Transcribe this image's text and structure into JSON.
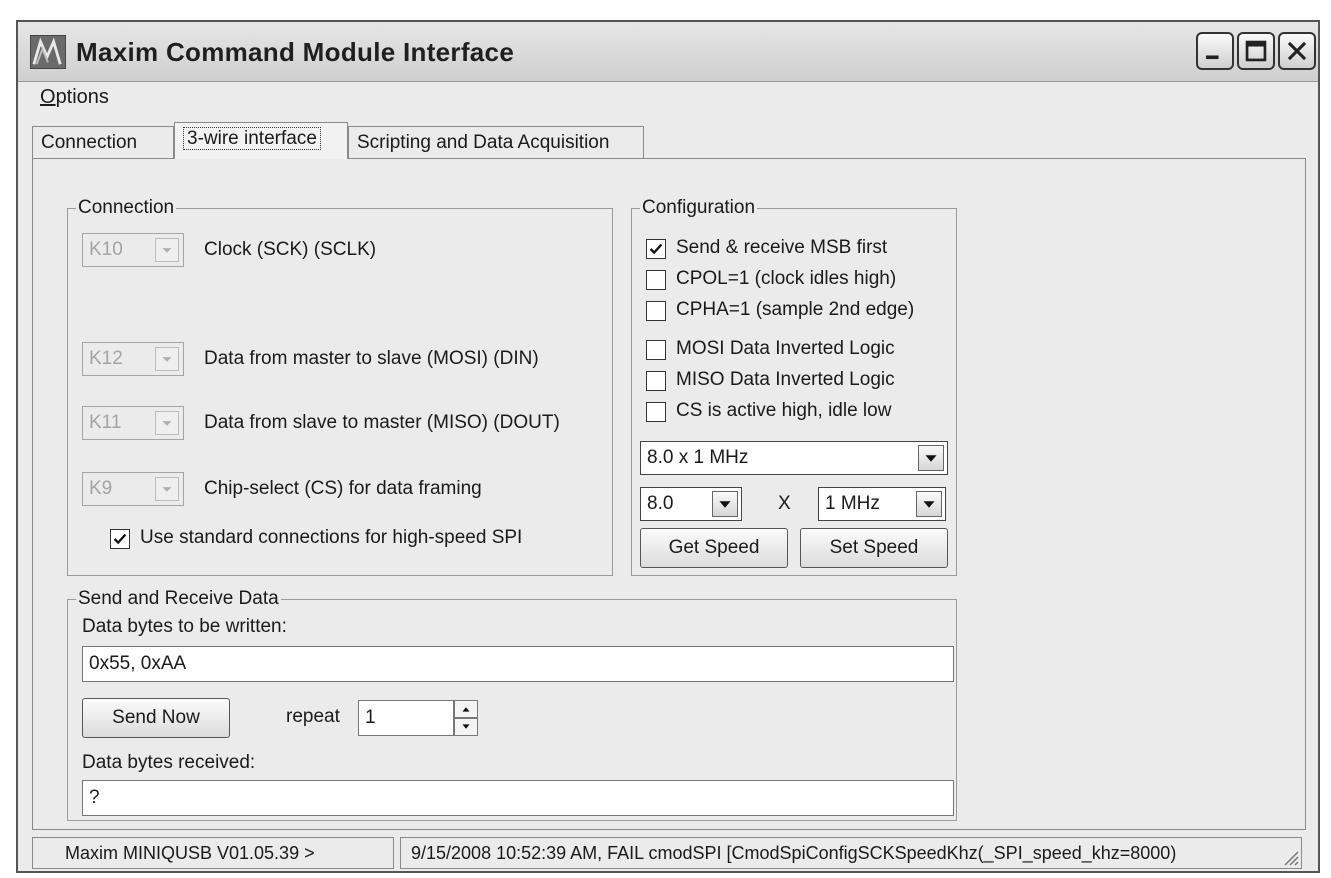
{
  "window": {
    "title": "Maxim Command Module Interface",
    "buttons": {
      "minimize": "minimize",
      "maximize": "maximize",
      "close": "close"
    }
  },
  "menu": {
    "options_first": "O",
    "options_rest": "ptions"
  },
  "tabs": [
    {
      "label": "Connection"
    },
    {
      "label": "3-wire interface",
      "selected": true
    },
    {
      "label": "Scripting and Data Acquisition"
    }
  ],
  "connection": {
    "legend": "Connection",
    "rows": [
      {
        "value": "K10",
        "label": "Clock (SCK) (SCLK)"
      },
      {
        "value": "K12",
        "label": "Data from master to slave (MOSI) (DIN)"
      },
      {
        "value": "K11",
        "label": "Data from slave to master (MISO) (DOUT)"
      },
      {
        "value": "K9",
        "label": "Chip-select (CS) for data framing"
      }
    ],
    "use_standard": {
      "label": "Use standard connections for high-speed SPI",
      "checked": true
    }
  },
  "configuration": {
    "legend": "Configuration",
    "options": [
      {
        "label": "Send & receive MSB first",
        "checked": true
      },
      {
        "label": "CPOL=1 (clock idles high)",
        "checked": false
      },
      {
        "label": "CPHA=1 (sample 2nd edge)",
        "checked": false
      },
      {
        "label": "MOSI Data Inverted Logic",
        "checked": false
      },
      {
        "label": "MISO Data Inverted Logic",
        "checked": false
      },
      {
        "label": "CS is active high, idle low",
        "checked": false
      }
    ],
    "speed_select": "8.0 x 1 MHz",
    "multiplier": "8.0",
    "times": "X",
    "unit": "1 MHz",
    "get_speed": "Get Speed",
    "set_speed": "Set Speed"
  },
  "send_receive": {
    "legend": "Send and Receive Data",
    "write_label": "Data bytes to be written:",
    "write_value": "0x55, 0xAA",
    "send_button": "Send Now",
    "repeat_label": "repeat",
    "repeat_value": "1",
    "received_label": "Data bytes received:",
    "received_value": "?"
  },
  "status": {
    "left": "Maxim MINIQUSB V01.05.39 >",
    "right": "9/15/2008 10:52:39 AM, FAIL cmodSPI [CmodSpiConfigSCKSpeedKhz(_SPI_speed_khz=8000)"
  }
}
